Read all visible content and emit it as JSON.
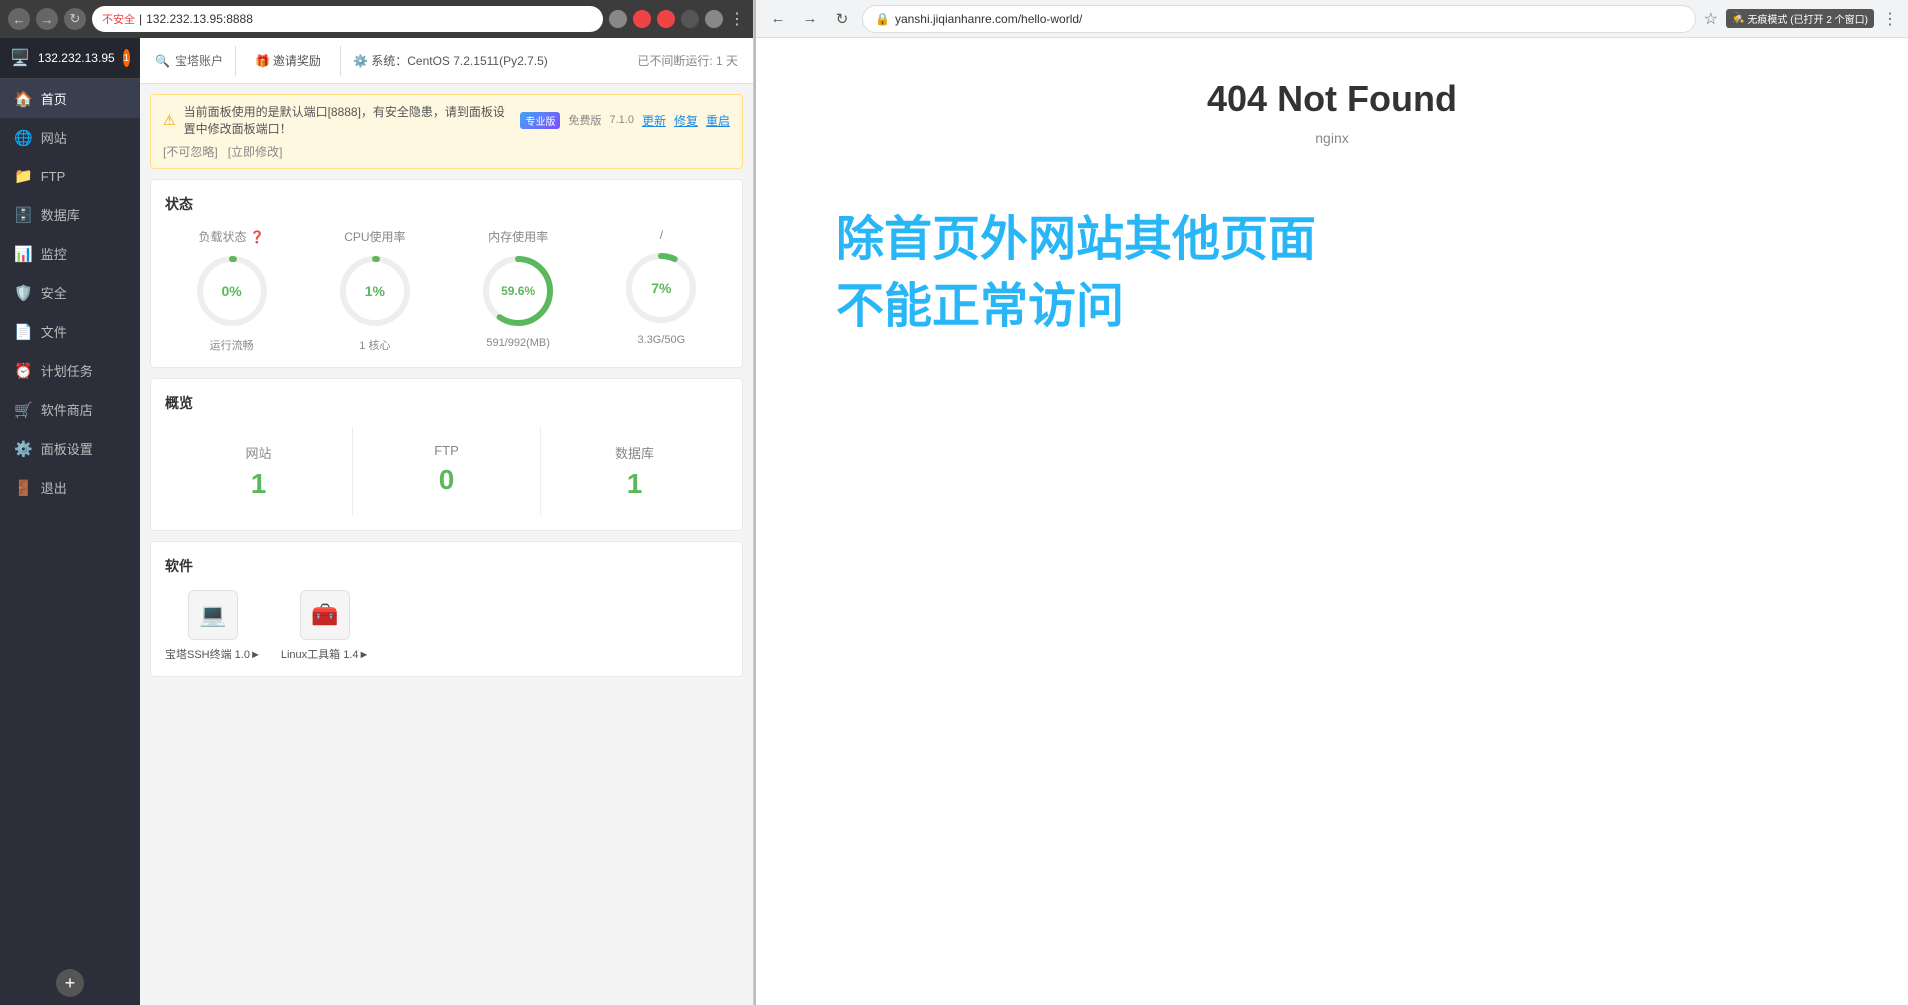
{
  "left_browser": {
    "address": "132.232.13.95:8888",
    "insecure_label": "不安全",
    "server_ip": "132.232.13.95",
    "badge_count": "1"
  },
  "topbar": {
    "search_placeholder": "宝塔账户",
    "invite_label": "邀请奖励",
    "system_label": "系统：CentOS 7.2.1511(Py2.7.5)",
    "uptime_label": "已不间断运行: 1 天"
  },
  "alert": {
    "text": "当前面板使用的是默认端口[8888]，有安全隐患，请到面板设置中修改面板端口！",
    "pro_label": "专业版",
    "free_label": "免费版",
    "version": "7.1.0",
    "update_label": "更新",
    "fix_label": "修复",
    "restart_label": "重启",
    "dismiss_label": "不可忽略",
    "fix_now_label": "立即修改"
  },
  "status": {
    "title": "状态",
    "load_label": "负载状态",
    "cpu_label": "CPU使用率",
    "mem_label": "内存使用率",
    "disk_label": "/",
    "load_value": "0%",
    "cpu_value": "1%",
    "mem_value": "59.6%",
    "disk_value": "7%",
    "load_sub": "运行流畅",
    "cpu_sub": "1 核心",
    "mem_sub": "591/992(MB)",
    "disk_sub": "3.3G/50G",
    "mem_percent": 59.6,
    "disk_percent": 7,
    "cpu_percent": 1,
    "load_percent": 0
  },
  "overview": {
    "title": "概览",
    "items": [
      {
        "name": "网站",
        "count": "1"
      },
      {
        "name": "FTP",
        "count": "0"
      },
      {
        "name": "数据库",
        "count": "1"
      }
    ]
  },
  "software": {
    "title": "软件",
    "items": [
      {
        "name": "宝塔SSH终端 1.0►",
        "icon": "💻"
      },
      {
        "name": "Linux工具箱 1.4►",
        "icon": "🧰"
      }
    ]
  },
  "sidebar": {
    "server": "132.232.13.95",
    "items": [
      {
        "label": "首页",
        "icon": "🏠"
      },
      {
        "label": "网站",
        "icon": "🌐"
      },
      {
        "label": "FTP",
        "icon": "📁"
      },
      {
        "label": "数据库",
        "icon": "🗄️"
      },
      {
        "label": "监控",
        "icon": "📊"
      },
      {
        "label": "安全",
        "icon": "🛡️"
      },
      {
        "label": "文件",
        "icon": "📄"
      },
      {
        "label": "计划任务",
        "icon": "⏰"
      },
      {
        "label": "软件商店",
        "icon": "🛒"
      },
      {
        "label": "面板设置",
        "icon": "⚙️"
      },
      {
        "label": "退出",
        "icon": "🚪"
      }
    ]
  },
  "right_browser": {
    "url": "yanshi.jiqianhanre.com/hello-world/",
    "incognito_label": "无痕模式 (已打开 2 个窗口)",
    "title": "404 Not Found",
    "subtitle": "nginx",
    "chinese_text_line1": "除首页外网站其他页面",
    "chinese_text_line2": "不能正常访问"
  }
}
